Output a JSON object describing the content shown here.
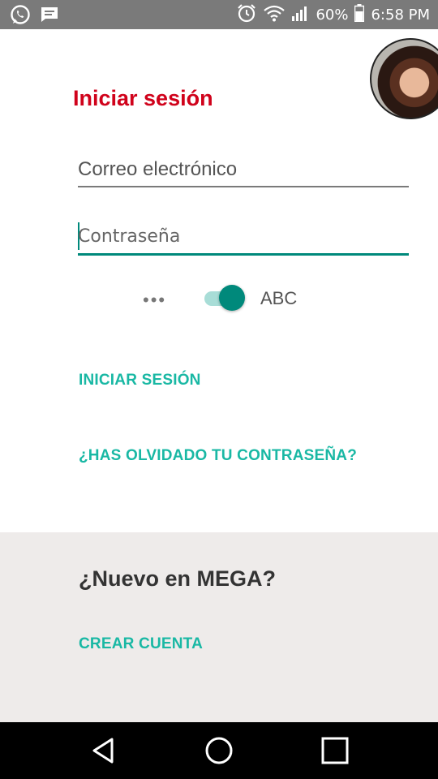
{
  "status_bar": {
    "battery_percent": "60%",
    "time": "6:58 PM",
    "icons": [
      "whatsapp-icon",
      "message-icon",
      "alarm-icon",
      "wifi-icon",
      "signal-icon",
      "battery-icon"
    ]
  },
  "login": {
    "title": "Iniciar sesión",
    "email_placeholder": "Correo electrónico",
    "password_placeholder": "Contraseña",
    "toggle_hidden_label": "•••",
    "toggle_visible_label": "ABC",
    "login_button": "INICIAR SESIÓN",
    "forgot_password": "¿HAS OLVIDADO TU CONTRASEÑA?"
  },
  "signup": {
    "title": "¿Nuevo en MEGA?",
    "create_account": "CREAR CUENTA"
  },
  "colors": {
    "title_red": "#d0021b",
    "accent_teal": "#00897b",
    "link_teal": "#19b8a4",
    "footer_bg": "#eeebea"
  },
  "nav_bar": {
    "icons": [
      "back-icon",
      "home-icon",
      "recents-icon"
    ]
  }
}
